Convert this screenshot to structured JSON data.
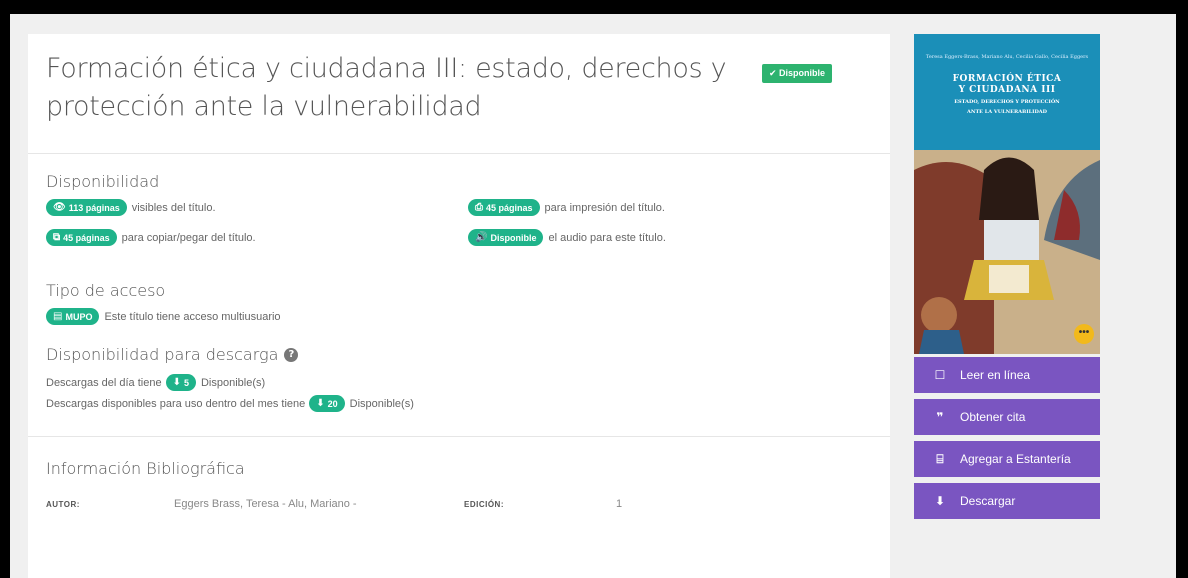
{
  "book": {
    "title": "Formación ética y ciudadana III: estado, derechos y protección ante la vulnerabilidad",
    "status": "✔ Disponible"
  },
  "availability": {
    "heading": "Disponibilidad",
    "visible_pill": "113 páginas",
    "visible_text": "visibles del título.",
    "print_pill": "45 páginas",
    "print_text": "para impresión del título.",
    "copy_pill": "45 páginas",
    "copy_text": "para copiar/pegar del título.",
    "audio_pill": "Disponible",
    "audio_text": "el audio para este título."
  },
  "access": {
    "heading": "Tipo de acceso",
    "pill": "MUPO",
    "text": "Este título tiene acceso multiusuario"
  },
  "downloads": {
    "heading": "Disponibilidad para descarga",
    "day_text": "Descargas del día tiene",
    "day_pill": "5",
    "day_suffix": "Disponible(s)",
    "month_text": "Descargas disponibles para uso dentro del mes tiene",
    "month_pill": "20",
    "month_suffix": "Disponible(s)"
  },
  "biblio": {
    "heading": "Información Bibliográfica",
    "author_label": "AUTOR:",
    "author_value": "Eggers Brass, Teresa - Alu, Mariano -",
    "edition_label": "EDICIÓN:",
    "edition_value": "1"
  },
  "cover": {
    "authors": "Teresa Eggers-Brass, Mariano Alu, Cecilia Gallo, Cecilia Eggers",
    "title_line1": "FORMACIÓN ÉTICA",
    "title_line2": "Y CIUDADANA III",
    "subtitle_line1": "ESTADO, DERECHOS Y PROTECCIÓN",
    "subtitle_line2": "ANTE LA VULNERABILIDAD",
    "more": "•••"
  },
  "actions": {
    "read": "Leer en línea",
    "cite": "Obtener cita",
    "shelf": "Agregar a Estantería",
    "download": "Descargar"
  },
  "colors": {
    "pill": "#1fb38a",
    "status": "#2db36f",
    "action": "#7a55c1"
  }
}
